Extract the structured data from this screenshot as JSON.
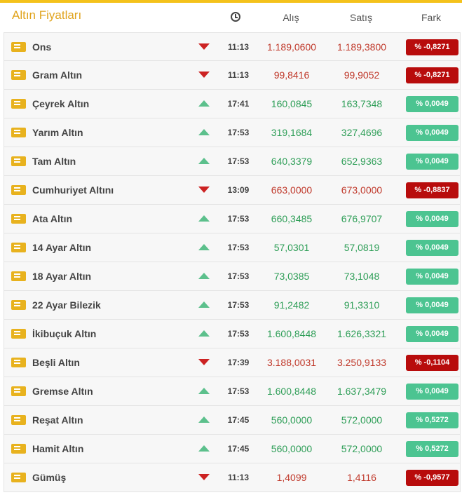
{
  "header": {
    "title": "Altın Fiyatları",
    "col_buy": "Alış",
    "col_sell": "Satış",
    "col_diff": "Fark",
    "time_icon": "clock-icon"
  },
  "colors": {
    "accent": "#f4c21b",
    "down": "#cc2222",
    "up": "#5cc08c",
    "badge_neg": "#b80c0c",
    "badge_pos": "#4cc491"
  },
  "rows": [
    {
      "name": "Ons",
      "dir": "down",
      "time": "11:13",
      "buy": "1.189,0600",
      "sell": "1.189,3800",
      "diff": "% -0,8271"
    },
    {
      "name": "Gram Altın",
      "dir": "down",
      "time": "11:13",
      "buy": "99,8416",
      "sell": "99,9052",
      "diff": "% -0,8271"
    },
    {
      "name": "Çeyrek Altın",
      "dir": "up",
      "time": "17:41",
      "buy": "160,0845",
      "sell": "163,7348",
      "diff": "% 0,0049"
    },
    {
      "name": "Yarım Altın",
      "dir": "up",
      "time": "17:53",
      "buy": "319,1684",
      "sell": "327,4696",
      "diff": "% 0,0049"
    },
    {
      "name": "Tam Altın",
      "dir": "up",
      "time": "17:53",
      "buy": "640,3379",
      "sell": "652,9363",
      "diff": "% 0,0049"
    },
    {
      "name": "Cumhuriyet Altını",
      "dir": "down",
      "time": "13:09",
      "buy": "663,0000",
      "sell": "673,0000",
      "diff": "% -0,8837"
    },
    {
      "name": "Ata Altın",
      "dir": "up",
      "time": "17:53",
      "buy": "660,3485",
      "sell": "676,9707",
      "diff": "% 0,0049"
    },
    {
      "name": "14 Ayar Altın",
      "dir": "up",
      "time": "17:53",
      "buy": "57,0301",
      "sell": "57,0819",
      "diff": "% 0,0049"
    },
    {
      "name": "18 Ayar Altın",
      "dir": "up",
      "time": "17:53",
      "buy": "73,0385",
      "sell": "73,1048",
      "diff": "% 0,0049"
    },
    {
      "name": "22 Ayar Bilezik",
      "dir": "up",
      "time": "17:53",
      "buy": "91,2482",
      "sell": "91,3310",
      "diff": "% 0,0049"
    },
    {
      "name": "İkibuçuk Altın",
      "dir": "up",
      "time": "17:53",
      "buy": "1.600,8448",
      "sell": "1.626,3321",
      "diff": "% 0,0049"
    },
    {
      "name": "Beşli Altın",
      "dir": "down",
      "time": "17:39",
      "buy": "3.188,0031",
      "sell": "3.250,9133",
      "diff": "% -0,1104"
    },
    {
      "name": "Gremse Altın",
      "dir": "up",
      "time": "17:53",
      "buy": "1.600,8448",
      "sell": "1.637,3479",
      "diff": "% 0,0049"
    },
    {
      "name": "Reşat Altın",
      "dir": "up",
      "time": "17:45",
      "buy": "560,0000",
      "sell": "572,0000",
      "diff": "% 0,5272"
    },
    {
      "name": "Hamit Altın",
      "dir": "up",
      "time": "17:45",
      "buy": "560,0000",
      "sell": "572,0000",
      "diff": "% 0,5272"
    },
    {
      "name": "Gümüş",
      "dir": "down",
      "time": "11:13",
      "buy": "1,4099",
      "sell": "1,4116",
      "diff": "% -0,9577"
    }
  ]
}
